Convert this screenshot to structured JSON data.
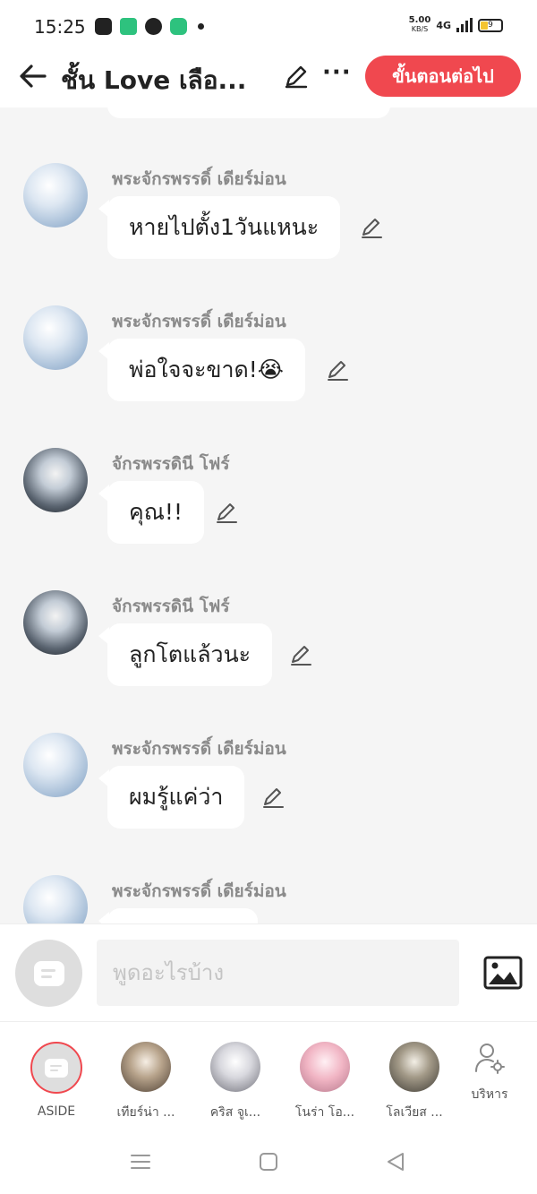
{
  "status_bar": {
    "time": "15:25",
    "net_speed": "5.00",
    "net_unit": "KB/S",
    "network": "4G",
    "battery": "9"
  },
  "header": {
    "title": "ชั้น Love เลือ...",
    "next_button": "ขั้นตอนต่อไป"
  },
  "messages": [
    {
      "sender": "พระจักรพรรดิ์ เดียร์ม่อน",
      "text": "หายไปตั้ง1วันแหนะ",
      "avatar": "emperor"
    },
    {
      "sender": "พระจักรพรรดิ์ เดียร์ม่อน",
      "text": "พ่อใจจะขาด!😭",
      "avatar": "emperor"
    },
    {
      "sender": "จักรพรรดินี โฟร์",
      "text": "คุณ!!",
      "avatar": "frost"
    },
    {
      "sender": "จักรพรรดินี โฟร์",
      "text": "ลูกโตแล้วนะ",
      "avatar": "frost"
    },
    {
      "sender": "พระจักรพรรดิ์ เดียร์ม่อน",
      "text": "ผมรู้แค่ว่า",
      "avatar": "emperor"
    },
    {
      "sender": "พระจักรพรรดิ์ เดียร์ม่อน",
      "text": "",
      "avatar": "emperor"
    }
  ],
  "input": {
    "placeholder": "พูดอะไรบ้าง"
  },
  "characters": [
    {
      "name": "ASIDE"
    },
    {
      "name": "เทียร์น่า ..."
    },
    {
      "name": "คริส จูเ..."
    },
    {
      "name": "โนร่า โอ..."
    },
    {
      "name": "โลเวียส ..."
    },
    {
      "name": "บริหาร"
    }
  ],
  "colors": {
    "accent": "#f0484f",
    "background": "#f5f5f5",
    "sender_text": "#8a8a8a"
  }
}
